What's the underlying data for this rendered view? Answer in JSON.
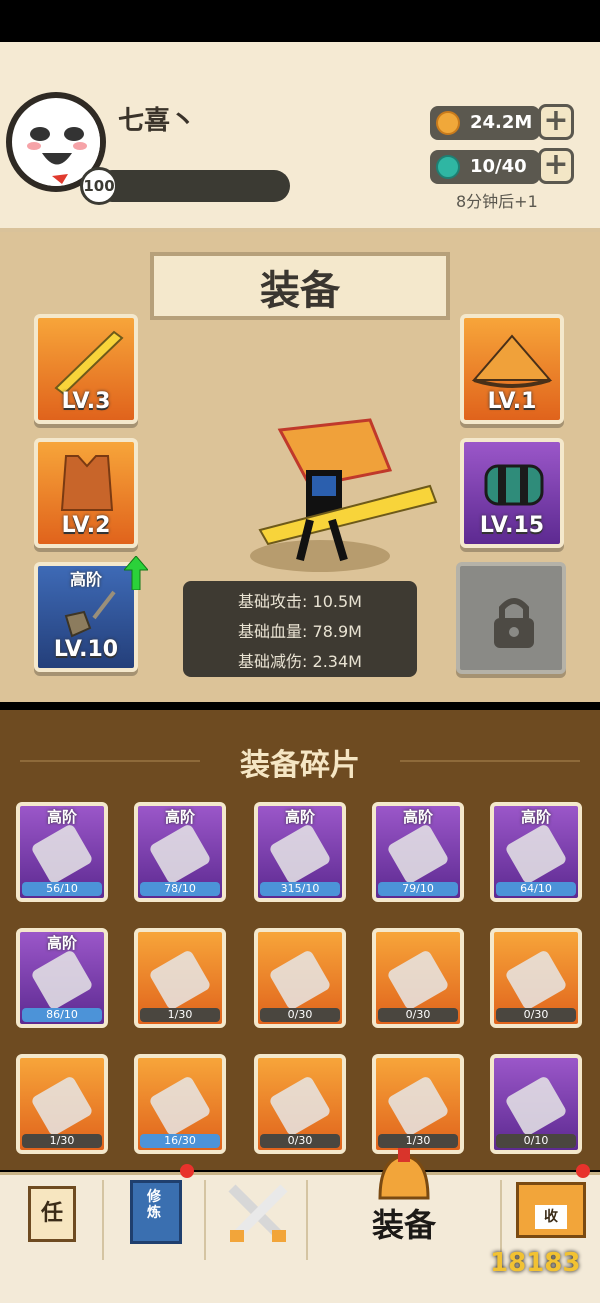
{
  "profile": {
    "name": "七喜丶",
    "level": "100"
  },
  "resources": {
    "coins": {
      "value": "24.2M",
      "icon": "coin-icon"
    },
    "energy": {
      "value": "10/40",
      "icon": "energy-orb-icon"
    },
    "timer": "8分钟后+1"
  },
  "equipment": {
    "title": "装备",
    "slots": [
      {
        "id": "weapon",
        "level": "LV.3",
        "icon": "sword-icon"
      },
      {
        "id": "armor",
        "level": "LV.2",
        "icon": "vest-icon"
      },
      {
        "id": "necklace",
        "tier": "高阶",
        "level": "LV.10",
        "icon": "necklace-icon"
      },
      {
        "id": "hat",
        "level": "LV.1",
        "icon": "straw-hat-icon"
      },
      {
        "id": "gauntlet",
        "level": "LV.15",
        "icon": "gauntlet-icon"
      },
      {
        "id": "locked",
        "icon": "lock-icon"
      }
    ],
    "stats": {
      "attack": "基础攻击: 10.5M",
      "hp": "基础血量: 78.9M",
      "defense": "基础减伤: 2.34M"
    }
  },
  "fragments": {
    "title": "装备碎片",
    "items": [
      {
        "tier": "高阶",
        "count": "56/10",
        "icon": "broadsword-icon"
      },
      {
        "tier": "高阶",
        "count": "78/10",
        "icon": "curved-blade-icon"
      },
      {
        "tier": "高阶",
        "count": "315/10",
        "icon": "spiked-gauntlet-icon"
      },
      {
        "tier": "高阶",
        "count": "79/10",
        "icon": "cleaver-icon"
      },
      {
        "tier": "高阶",
        "count": "64/10",
        "icon": "straw-hat-icon"
      },
      {
        "tier": "高阶",
        "count": "86/10",
        "icon": "armor-orb-icon"
      },
      {
        "tier": "",
        "count": "1/30",
        "icon": "staff-icon"
      },
      {
        "tier": "",
        "count": "0/30",
        "icon": "axe-icon"
      },
      {
        "tier": "",
        "count": "0/30",
        "icon": "sword-icon"
      },
      {
        "tier": "",
        "count": "0/30",
        "icon": "spear-icon"
      },
      {
        "tier": "",
        "count": "1/30",
        "icon": "straw-hat-icon"
      },
      {
        "tier": "",
        "count": "16/30",
        "icon": "headband-icon"
      },
      {
        "tier": "",
        "count": "0/30",
        "icon": "cloak-icon"
      },
      {
        "tier": "",
        "count": "1/30",
        "icon": "vest-icon"
      },
      {
        "tier": "",
        "count": "0/10",
        "icon": "gauntlet-icon"
      }
    ]
  },
  "nav": {
    "task": "任",
    "cultivate": "修炼",
    "battle": "battle-swords-icon",
    "equip": "装备",
    "shop": "收"
  },
  "watermark": "18183"
}
